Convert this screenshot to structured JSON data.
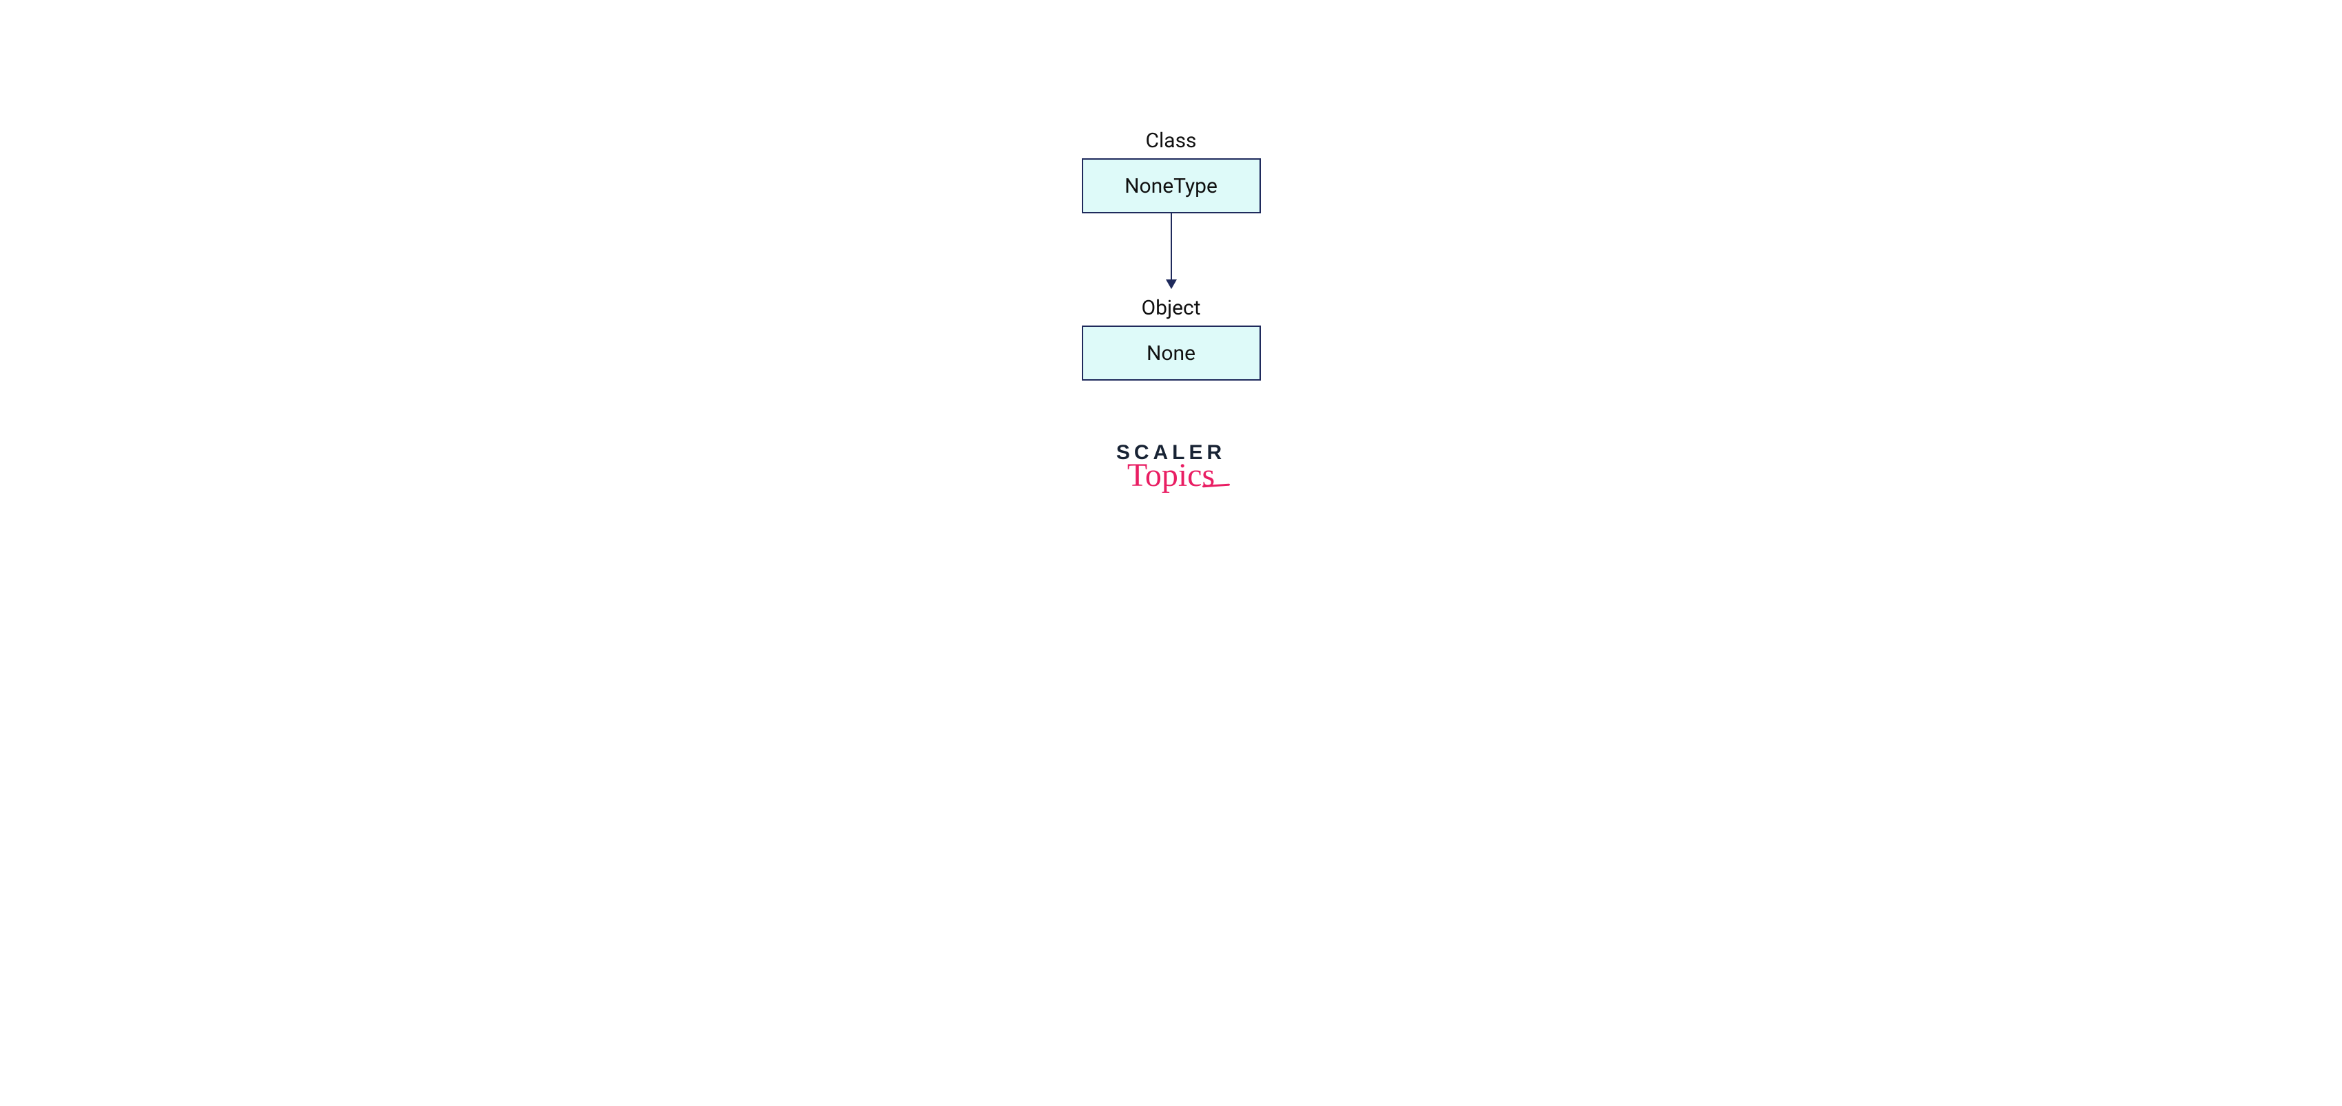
{
  "diagram": {
    "class_label": "Class",
    "class_box": "NoneType",
    "object_label": "Object",
    "object_box": "None"
  },
  "branding": {
    "line1": "SCALER",
    "line2": "Topics"
  },
  "colors": {
    "box_border": "#1f2a5c",
    "box_fill": "#defaf9",
    "arrow": "#1f2a5c",
    "logo_dark": "#182334",
    "logo_accent": "#e91e63"
  }
}
